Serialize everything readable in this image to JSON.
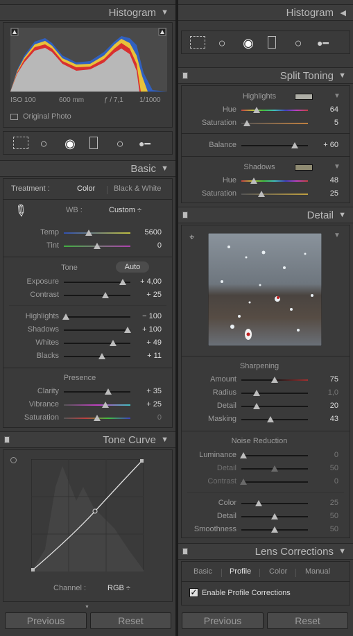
{
  "left": {
    "histogram": {
      "title": "Histogram",
      "iso": "ISO 100",
      "focal": "600 mm",
      "aperture": "ƒ / 7,1",
      "shutter": "1/1000",
      "original_photo": "Original Photo"
    },
    "basic": {
      "title": "Basic",
      "treatment_label": "Treatment :",
      "treatment_color": "Color",
      "treatment_bw": "Black & White",
      "wb_label": "WB :",
      "wb_value": "Custom ÷",
      "temp": {
        "label": "Temp",
        "value": "5600"
      },
      "tint": {
        "label": "Tint",
        "value": "0"
      },
      "tone_label": "Tone",
      "auto": "Auto",
      "exposure": {
        "label": "Exposure",
        "value": "+ 4,00"
      },
      "contrast": {
        "label": "Contrast",
        "value": "+ 25"
      },
      "highlights": {
        "label": "Highlights",
        "value": "− 100"
      },
      "shadows": {
        "label": "Shadows",
        "value": "+ 100"
      },
      "whites": {
        "label": "Whites",
        "value": "+ 49"
      },
      "blacks": {
        "label": "Blacks",
        "value": "+ 11"
      },
      "presence_label": "Presence",
      "clarity": {
        "label": "Clarity",
        "value": "+ 35"
      },
      "vibrance": {
        "label": "Vibrance",
        "value": "+ 25"
      },
      "saturation": {
        "label": "Saturation",
        "value": "0"
      }
    },
    "tone_curve": {
      "title": "Tone Curve",
      "channel_label": "Channel :",
      "channel_value": "RGB ÷"
    },
    "previous": "Previous",
    "reset": "Reset"
  },
  "right": {
    "histogram": {
      "title": "Histogram"
    },
    "split_toning": {
      "title": "Split Toning",
      "highlights_label": "Highlights",
      "hl_hue": {
        "label": "Hue",
        "value": "64"
      },
      "hl_sat": {
        "label": "Saturation",
        "value": "5"
      },
      "balance": {
        "label": "Balance",
        "value": "+ 60"
      },
      "shadows_label": "Shadows",
      "sh_hue": {
        "label": "Hue",
        "value": "48"
      },
      "sh_sat": {
        "label": "Saturation",
        "value": "25"
      }
    },
    "detail": {
      "title": "Detail",
      "sharpening_label": "Sharpening",
      "amount": {
        "label": "Amount",
        "value": "75"
      },
      "radius": {
        "label": "Radius",
        "value": "1,0"
      },
      "detail": {
        "label": "Detail",
        "value": "20"
      },
      "masking": {
        "label": "Masking",
        "value": "43"
      },
      "noise_label": "Noise Reduction",
      "luminance": {
        "label": "Luminance",
        "value": "0"
      },
      "lum_detail": {
        "label": "Detail",
        "value": "50"
      },
      "lum_contrast": {
        "label": "Contrast",
        "value": "0"
      },
      "color": {
        "label": "Color",
        "value": "25"
      },
      "color_detail": {
        "label": "Detail",
        "value": "50"
      },
      "smoothness": {
        "label": "Smoothness",
        "value": "50"
      }
    },
    "lens": {
      "title": "Lens Corrections",
      "tab_basic": "Basic",
      "tab_profile": "Profile",
      "tab_color": "Color",
      "tab_manual": "Manual",
      "enable_profile": "Enable Profile Corrections"
    },
    "previous": "Previous",
    "reset": "Reset"
  }
}
